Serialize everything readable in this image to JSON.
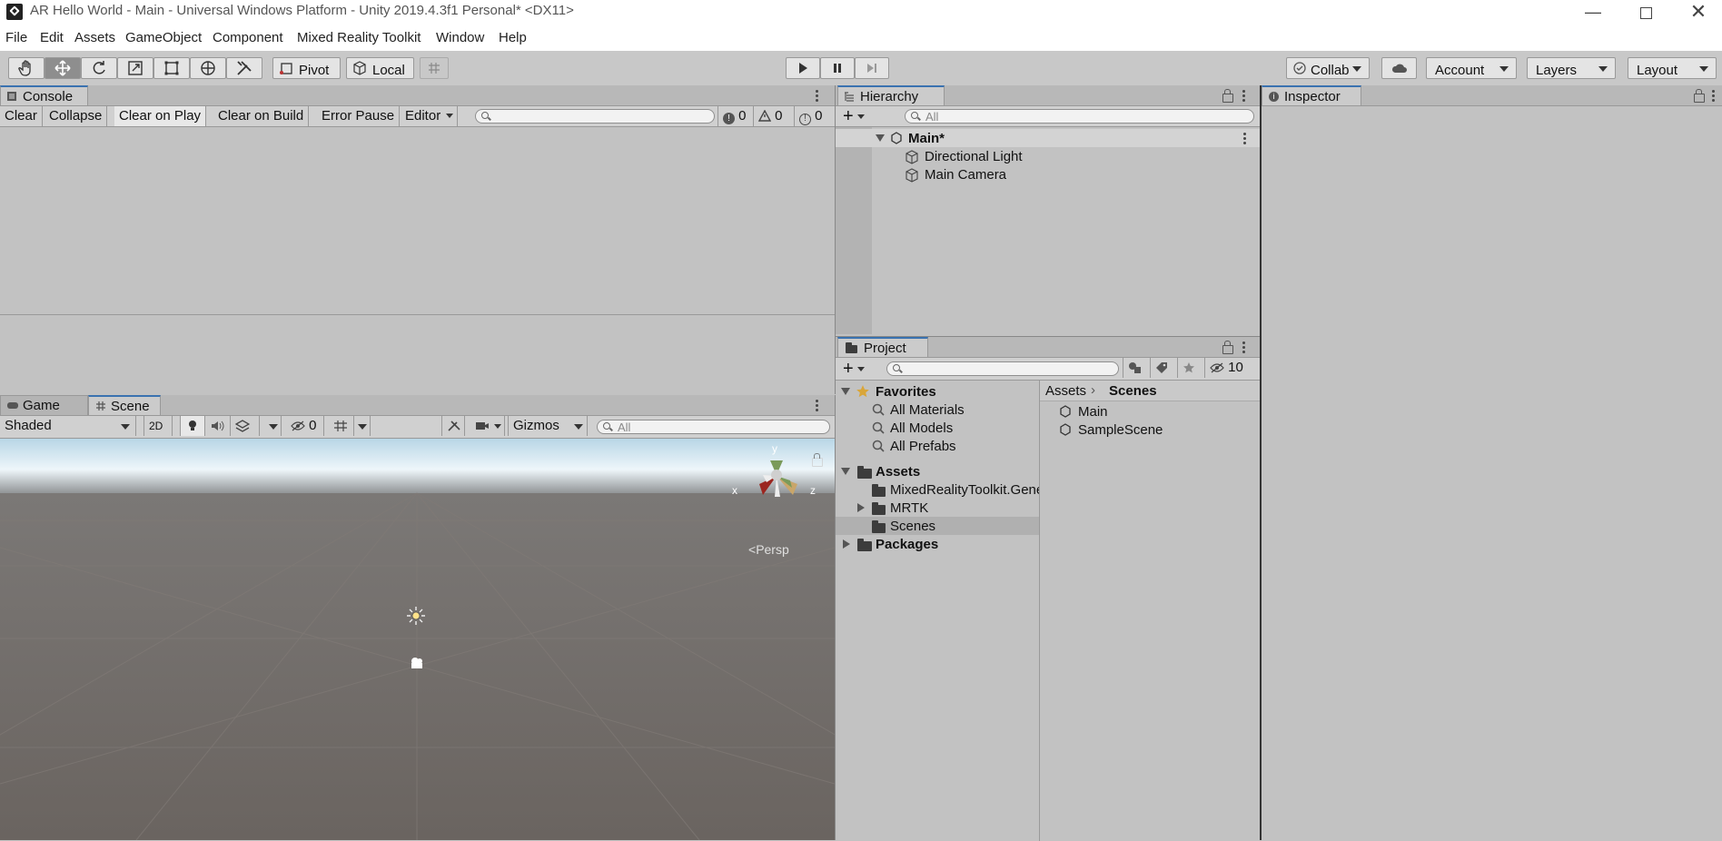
{
  "window": {
    "title": "AR Hello World - Main - Universal Windows Platform - Unity 2019.4.3f1 Personal* <DX11>"
  },
  "menu": [
    "File",
    "Edit",
    "Assets",
    "GameObject",
    "Component",
    "Mixed Reality Toolkit",
    "Window",
    "Help"
  ],
  "toolbar": {
    "tools": [
      "hand-tool",
      "move-tool",
      "rotate-tool",
      "scale-tool",
      "rect-tool",
      "transform-tool",
      "custom-tool"
    ],
    "pivot_label": "Pivot",
    "local_label": "Local",
    "collab_label": "Collab",
    "account_label": "Account",
    "layers_label": "Layers",
    "layout_label": "Layout"
  },
  "console": {
    "tab": "Console",
    "buttons": [
      "Clear",
      "Collapse",
      "Clear on Play",
      "Clear on Build",
      "Error Pause",
      "Editor"
    ],
    "counts": {
      "log": "0",
      "warning": "0",
      "error": "0"
    }
  },
  "scene": {
    "tabs": [
      "Game",
      "Scene"
    ],
    "shading": "Shaded",
    "mode_2d": "2D",
    "hidden_count": "0",
    "gizmos_label": "Gizmos",
    "search_placeholder": "All",
    "axes": {
      "x": "x",
      "y": "y",
      "z": "z"
    },
    "projection": "Persp"
  },
  "hierarchy": {
    "tab": "Hierarchy",
    "search_placeholder": "All",
    "scene_name": "Main*",
    "items": [
      "Directional Light",
      "Main Camera"
    ]
  },
  "project": {
    "tab": "Project",
    "hidden_packages_count": "10",
    "favorites_label": "Favorites",
    "favorites": [
      "All Materials",
      "All Models",
      "All Prefabs"
    ],
    "assets_label": "Assets",
    "asset_folders": [
      "MixedRealityToolkit.Generated",
      "MRTK",
      "Scenes"
    ],
    "packages_label": "Packages",
    "breadcrumb": [
      "Assets",
      "Scenes"
    ],
    "files": [
      "Main",
      "SampleScene"
    ]
  },
  "inspector": {
    "tab": "Inspector"
  },
  "colors": {
    "tab_accent": "#3a72b0",
    "selection": "#b0b0b0",
    "scene_ground": "#6a6460"
  }
}
